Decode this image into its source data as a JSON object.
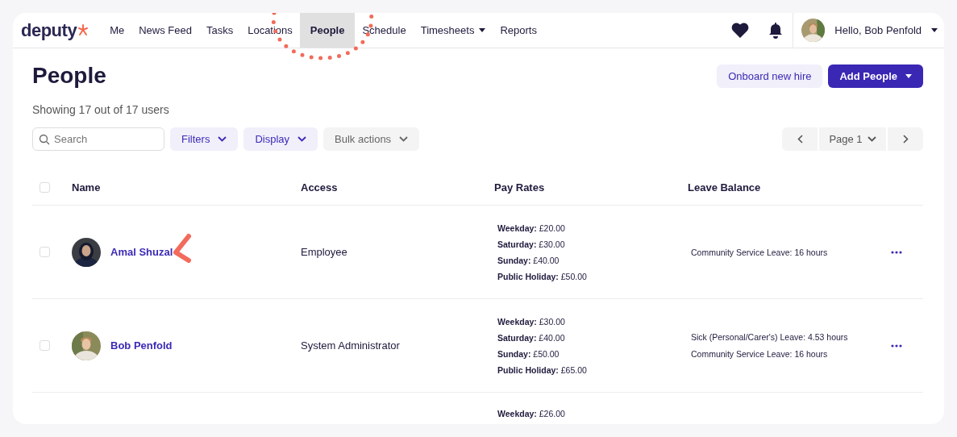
{
  "logo": {
    "text": "deputy"
  },
  "nav": [
    {
      "label": "Me",
      "selected": false,
      "kind": "link"
    },
    {
      "label": "News Feed",
      "selected": false,
      "kind": "link"
    },
    {
      "label": "Tasks",
      "selected": false,
      "kind": "link"
    },
    {
      "label": "Locations",
      "selected": false,
      "kind": "link"
    },
    {
      "label": "People",
      "selected": true,
      "kind": "link"
    },
    {
      "label": "Schedule",
      "selected": false,
      "kind": "link"
    },
    {
      "label": "Timesheets",
      "selected": false,
      "kind": "dropdown"
    },
    {
      "label": "Reports",
      "selected": false,
      "kind": "link"
    }
  ],
  "user_menu": {
    "greeting": "Hello, Bob Penfold"
  },
  "page": {
    "title": "People",
    "count": "Showing 17 out of 17 users"
  },
  "actions": [
    {
      "label": "Onboard new hire",
      "kind": "secondary"
    },
    {
      "label": "Add People",
      "kind": "primary"
    }
  ],
  "search": {
    "placeholder": "Search"
  },
  "filters": [
    {
      "label": "Filters",
      "kind": "accent"
    },
    {
      "label": "Display",
      "kind": "accent"
    },
    {
      "label": "Bulk actions",
      "kind": "neutral"
    }
  ],
  "pagination": {
    "page": "Page 1"
  },
  "table": {
    "columns": [
      "Name",
      "Access",
      "Pay Rates",
      "Leave Balance"
    ],
    "select_all": {
      "checked": false
    },
    "rows": [
      {
        "checked": false,
        "name": "Amal Shuzal",
        "access": "Employee",
        "pay_rates": [
          {
            "label": "Weekday:",
            "value": "£20.00"
          },
          {
            "label": "Saturday:",
            "value": "£30.00"
          },
          {
            "label": "Sunday:",
            "value": "£40.00"
          },
          {
            "label": "Public Holiday:",
            "value": "£50.00"
          }
        ],
        "leave": [
          "Community Service Leave: 16 hours"
        ]
      },
      {
        "checked": false,
        "name": "Bob Penfold",
        "access": "System Administrator",
        "pay_rates": [
          {
            "label": "Weekday:",
            "value": "£30.00"
          },
          {
            "label": "Saturday:",
            "value": "£40.00"
          },
          {
            "label": "Sunday:",
            "value": "£50.00"
          },
          {
            "label": "Public Holiday:",
            "value": "£65.00"
          }
        ],
        "leave": [
          "Sick (Personal/Carer's) Leave: 4.53 hours",
          "Community Service Leave: 16 hours"
        ]
      },
      {
        "pay_rates": [
          {
            "label": "Weekday:",
            "value": "£26.00"
          }
        ]
      }
    ]
  }
}
